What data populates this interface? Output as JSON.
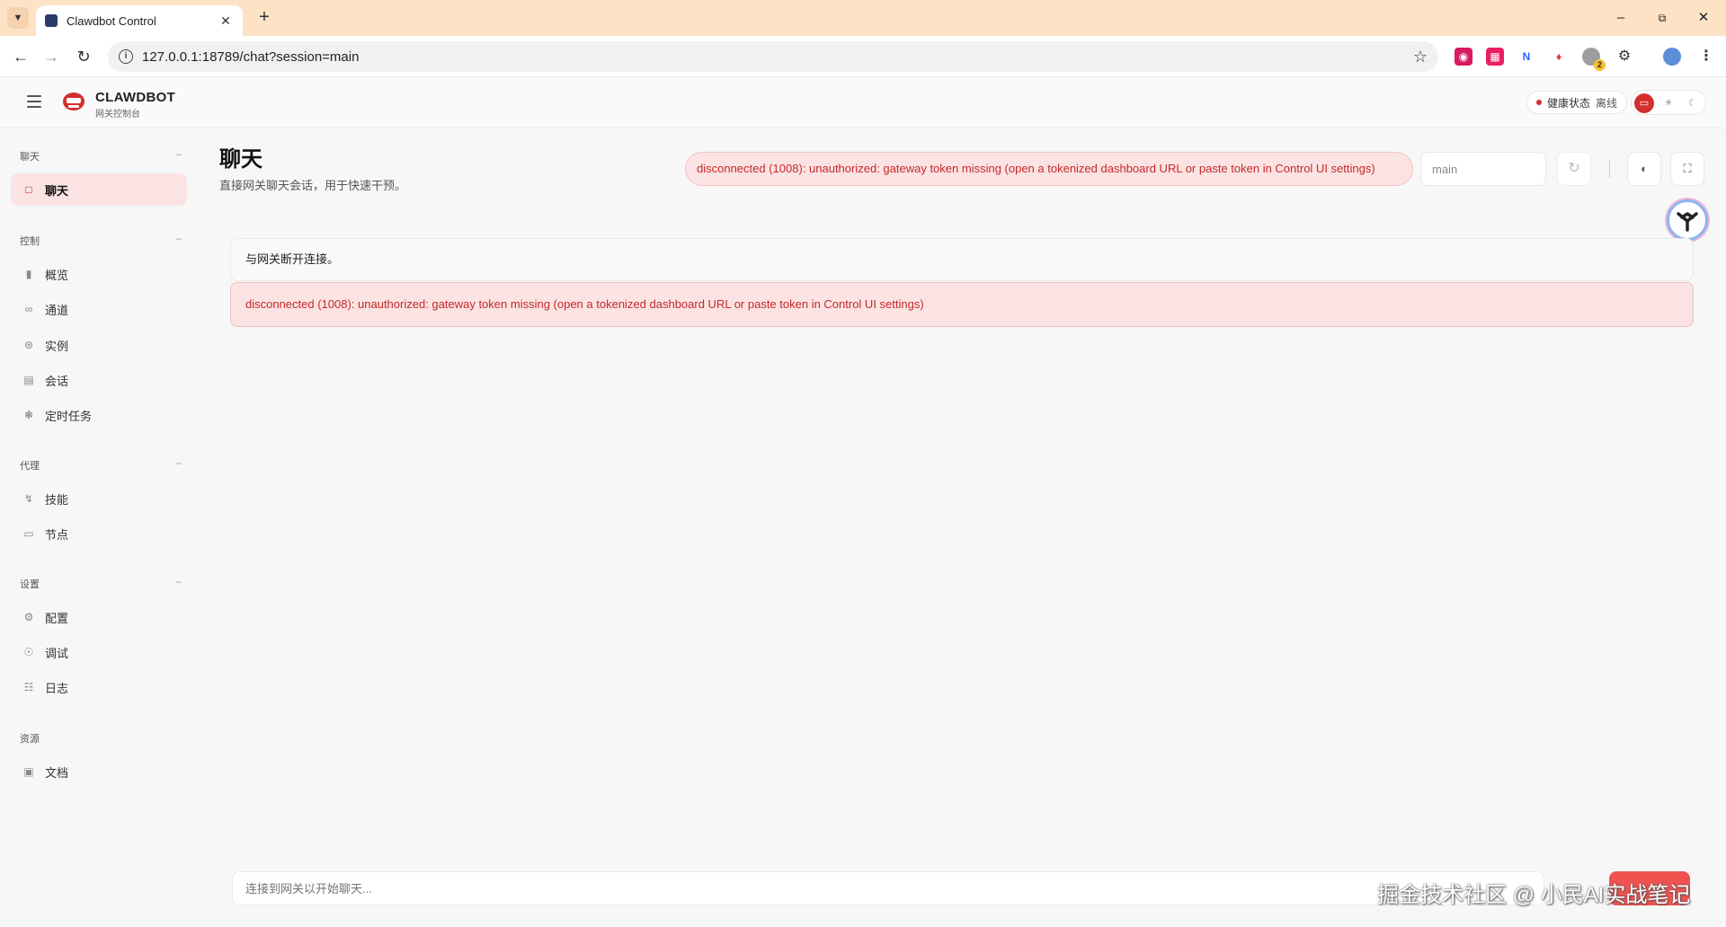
{
  "browser": {
    "tab_title": "Clawdbot Control",
    "url": "127.0.0.1:18789/chat?session=main",
    "extension_badge": "2"
  },
  "header": {
    "brand_name": "CLAWDBOT",
    "brand_sub": "网关控制台",
    "health_label": "健康状态",
    "health_value": "离线"
  },
  "sidebar": {
    "groups": [
      {
        "title": "聊天",
        "items": [
          {
            "label": "聊天",
            "active": true
          }
        ]
      },
      {
        "title": "控制",
        "items": [
          {
            "label": "概览"
          },
          {
            "label": "通道"
          },
          {
            "label": "实例"
          },
          {
            "label": "会话"
          },
          {
            "label": "定时任务"
          }
        ]
      },
      {
        "title": "代理",
        "items": [
          {
            "label": "技能"
          },
          {
            "label": "节点"
          }
        ]
      },
      {
        "title": "设置",
        "items": [
          {
            "label": "配置"
          },
          {
            "label": "调试"
          },
          {
            "label": "日志"
          }
        ]
      },
      {
        "title": "资源",
        "items": [
          {
            "label": "文档"
          }
        ]
      }
    ]
  },
  "main": {
    "title": "聊天",
    "subtitle": "直接网关聊天会话，用于快速干预。",
    "error_pill": "disconnected (1008): unauthorized: gateway token missing (open a tokenized dashboard URL or paste token in Control UI settings)",
    "session_value": "main",
    "messages": {
      "disconnected": "与网关断开连接。",
      "error": "disconnected (1008): unauthorized: gateway token missing (open a tokenized dashboard URL or paste token in Control UI settings)"
    },
    "composer_placeholder": "连接到网关以开始聊天..."
  },
  "watermark": "掘金技术社区 @ 小民AI实战笔记",
  "colors": {
    "accent": "#c62828",
    "error_bg": "#fbe3e3",
    "tabbar": "#fde2c6"
  }
}
